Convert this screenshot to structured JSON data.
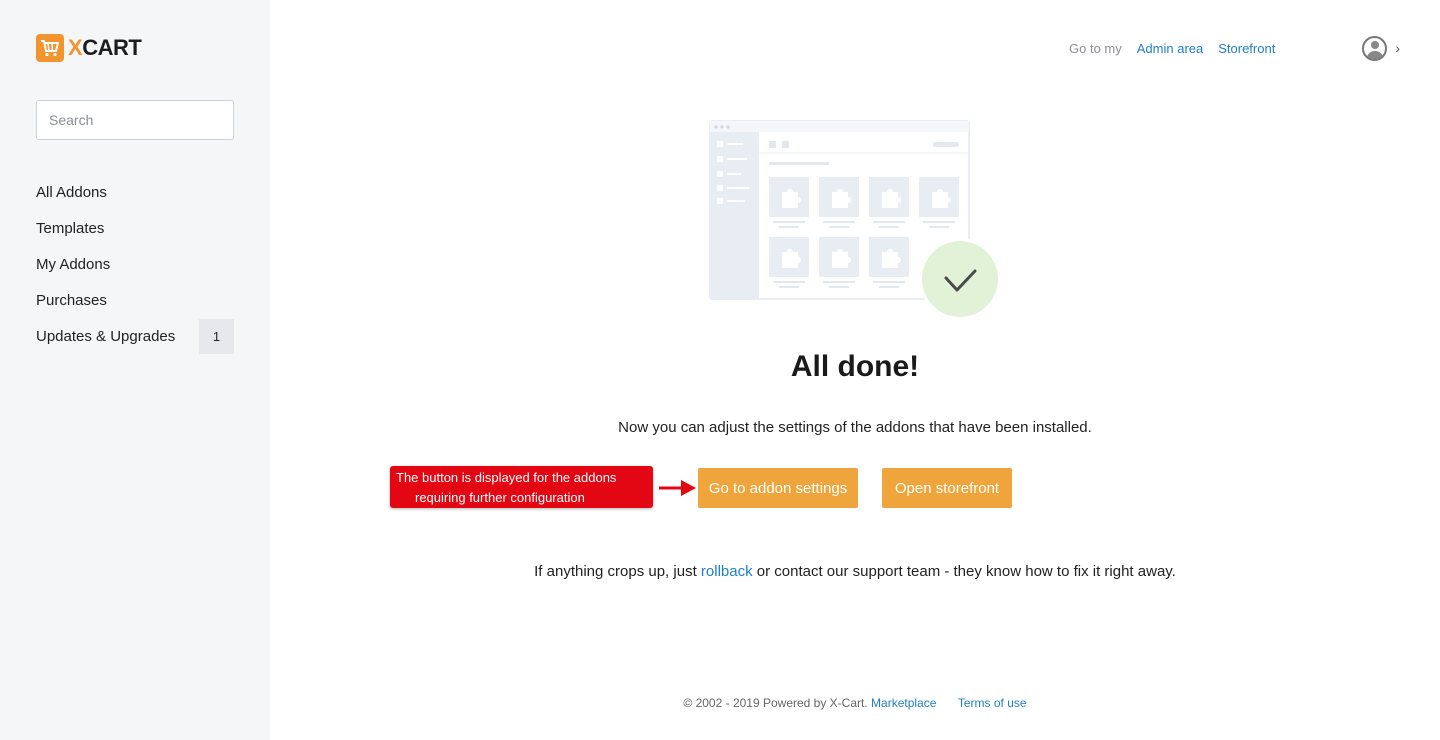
{
  "brand": {
    "logo_letter_x": "X",
    "logo_rest": "CART",
    "logo_icon": "cart-icon",
    "accent_color": "#f2952e"
  },
  "sidebar": {
    "search_placeholder": "Search",
    "items": [
      {
        "label": "All Addons"
      },
      {
        "label": "Templates"
      },
      {
        "label": "My Addons"
      },
      {
        "label": "Purchases"
      },
      {
        "label": "Updates & Upgrades",
        "badge": "1"
      }
    ]
  },
  "header": {
    "goto_label": "Go to my",
    "admin_link": "Admin area",
    "storefront_link": "Storefront",
    "user_icon": "user-avatar-icon",
    "menu_icon": "chevron-right-icon"
  },
  "main": {
    "title": "All done!",
    "subtitle": "Now you can adjust the settings of the addons that have been installed.",
    "primary_button": "Go to addon settings",
    "secondary_button": "Open storefront",
    "button_color": "#f0a53c",
    "note_before": "If anything crops up, just ",
    "note_link": "rollback",
    "note_after": " or contact our support team - they know how to fix it right away."
  },
  "callout": {
    "line1": "The button is displayed for the addons",
    "line2": "requiring further configuration",
    "color": "#e30613"
  },
  "footer": {
    "copyright": "© 2002 - 2019 Powered by X-Cart.",
    "marketplace_link": "Marketplace",
    "terms_link": "Terms of use"
  }
}
